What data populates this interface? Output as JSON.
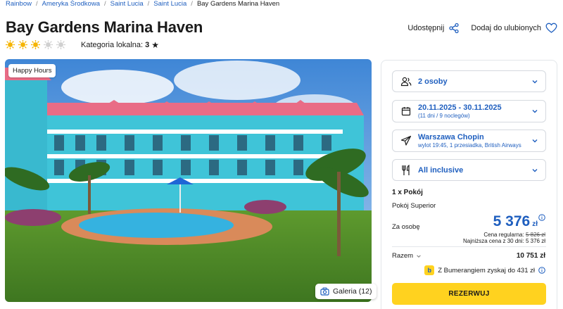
{
  "breadcrumb": [
    "Rainbow",
    "Ameryka Środkowa",
    "Saint Lucia",
    "Saint Lucia"
  ],
  "breadcrumb_current": "Bay Gardens Marina Haven",
  "hotel": {
    "name": "Bay Gardens Marina Haven",
    "rating_suns": 3,
    "rating_max": 5,
    "local_category_label": "Kategoria lokalna:",
    "local_category_value": "3"
  },
  "actions": {
    "share": "Udostępnij",
    "favorite": "Dodaj do ulubionych"
  },
  "photo": {
    "tag": "Happy Hours",
    "gallery": "Galeria (12)"
  },
  "booking": {
    "guests": "2 osoby",
    "dates": "20.11.2025 - 30.11.2025",
    "dates_sub": "(11 dni / 9 noclegów)",
    "departure": "Warszawa Chopin",
    "departure_sub": "wylot 19:45, 1 przesiadka, British Airways",
    "board": "All inclusive",
    "rooms": "1 x Pokój",
    "room_type": "Pokój Superior",
    "per_person_label": "Za osobę",
    "price": "5 376",
    "currency": "zł",
    "regular_label": "Cena regularna:",
    "regular_price": "5 826 zł",
    "lowest_price": "Najniższa cena z 30 dni: 5 376 zł",
    "total_label": "Razem",
    "total_value": "10 751 zł",
    "bumerang": "Z Bumerangiem zyskaj do 431 zł",
    "bumerang_badge": "b",
    "reserve": "REZERWUJ"
  },
  "colors": {
    "accent": "#1f5fbf",
    "cta": "#ffd21f",
    "sun": "#f5b400"
  }
}
